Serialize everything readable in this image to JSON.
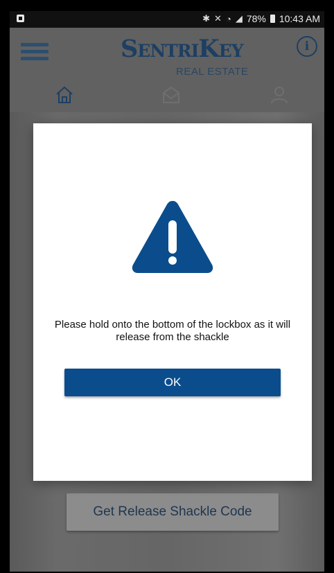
{
  "status_bar": {
    "battery_percent": "78%",
    "time": "10:43 AM",
    "icons": [
      "notification-icon",
      "bluetooth-icon",
      "mute-icon",
      "wifi-icon",
      "signal-icon",
      "battery-icon"
    ]
  },
  "header": {
    "logo_main": "SentriKey",
    "logo_sub": "REAL ESTATE",
    "info_symbol": "i"
  },
  "tabs": [
    {
      "name": "home",
      "icon": "home-icon"
    },
    {
      "name": "messages",
      "icon": "mail-icon"
    },
    {
      "name": "profile",
      "icon": "user-icon"
    }
  ],
  "background": {
    "release_button_label": "Get Release Shackle Code"
  },
  "dialog": {
    "icon": "warning-icon",
    "message": "Please hold onto the bottom of the lockbox as it will release from the shackle",
    "ok_label": "OK"
  },
  "colors": {
    "brand_blue": "#0b4d8c",
    "logo_navy": "#1c3f63",
    "overlay_gray": "#616161"
  }
}
